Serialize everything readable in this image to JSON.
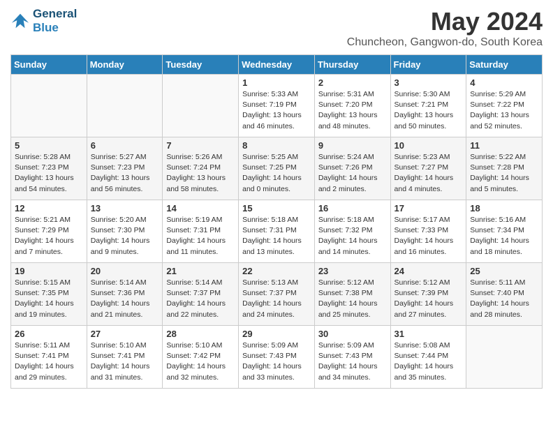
{
  "header": {
    "logo_line1": "General",
    "logo_line2": "Blue",
    "title": "May 2024",
    "subtitle": "Chuncheon, Gangwon-do, South Korea"
  },
  "weekdays": [
    "Sunday",
    "Monday",
    "Tuesday",
    "Wednesday",
    "Thursday",
    "Friday",
    "Saturday"
  ],
  "weeks": [
    [
      {
        "day": "",
        "info": ""
      },
      {
        "day": "",
        "info": ""
      },
      {
        "day": "",
        "info": ""
      },
      {
        "day": "1",
        "info": "Sunrise: 5:33 AM\nSunset: 7:19 PM\nDaylight: 13 hours and 46 minutes."
      },
      {
        "day": "2",
        "info": "Sunrise: 5:31 AM\nSunset: 7:20 PM\nDaylight: 13 hours and 48 minutes."
      },
      {
        "day": "3",
        "info": "Sunrise: 5:30 AM\nSunset: 7:21 PM\nDaylight: 13 hours and 50 minutes."
      },
      {
        "day": "4",
        "info": "Sunrise: 5:29 AM\nSunset: 7:22 PM\nDaylight: 13 hours and 52 minutes."
      }
    ],
    [
      {
        "day": "5",
        "info": "Sunrise: 5:28 AM\nSunset: 7:23 PM\nDaylight: 13 hours and 54 minutes."
      },
      {
        "day": "6",
        "info": "Sunrise: 5:27 AM\nSunset: 7:23 PM\nDaylight: 13 hours and 56 minutes."
      },
      {
        "day": "7",
        "info": "Sunrise: 5:26 AM\nSunset: 7:24 PM\nDaylight: 13 hours and 58 minutes."
      },
      {
        "day": "8",
        "info": "Sunrise: 5:25 AM\nSunset: 7:25 PM\nDaylight: 14 hours and 0 minutes."
      },
      {
        "day": "9",
        "info": "Sunrise: 5:24 AM\nSunset: 7:26 PM\nDaylight: 14 hours and 2 minutes."
      },
      {
        "day": "10",
        "info": "Sunrise: 5:23 AM\nSunset: 7:27 PM\nDaylight: 14 hours and 4 minutes."
      },
      {
        "day": "11",
        "info": "Sunrise: 5:22 AM\nSunset: 7:28 PM\nDaylight: 14 hours and 5 minutes."
      }
    ],
    [
      {
        "day": "12",
        "info": "Sunrise: 5:21 AM\nSunset: 7:29 PM\nDaylight: 14 hours and 7 minutes."
      },
      {
        "day": "13",
        "info": "Sunrise: 5:20 AM\nSunset: 7:30 PM\nDaylight: 14 hours and 9 minutes."
      },
      {
        "day": "14",
        "info": "Sunrise: 5:19 AM\nSunset: 7:31 PM\nDaylight: 14 hours and 11 minutes."
      },
      {
        "day": "15",
        "info": "Sunrise: 5:18 AM\nSunset: 7:31 PM\nDaylight: 14 hours and 13 minutes."
      },
      {
        "day": "16",
        "info": "Sunrise: 5:18 AM\nSunset: 7:32 PM\nDaylight: 14 hours and 14 minutes."
      },
      {
        "day": "17",
        "info": "Sunrise: 5:17 AM\nSunset: 7:33 PM\nDaylight: 14 hours and 16 minutes."
      },
      {
        "day": "18",
        "info": "Sunrise: 5:16 AM\nSunset: 7:34 PM\nDaylight: 14 hours and 18 minutes."
      }
    ],
    [
      {
        "day": "19",
        "info": "Sunrise: 5:15 AM\nSunset: 7:35 PM\nDaylight: 14 hours and 19 minutes."
      },
      {
        "day": "20",
        "info": "Sunrise: 5:14 AM\nSunset: 7:36 PM\nDaylight: 14 hours and 21 minutes."
      },
      {
        "day": "21",
        "info": "Sunrise: 5:14 AM\nSunset: 7:37 PM\nDaylight: 14 hours and 22 minutes."
      },
      {
        "day": "22",
        "info": "Sunrise: 5:13 AM\nSunset: 7:37 PM\nDaylight: 14 hours and 24 minutes."
      },
      {
        "day": "23",
        "info": "Sunrise: 5:12 AM\nSunset: 7:38 PM\nDaylight: 14 hours and 25 minutes."
      },
      {
        "day": "24",
        "info": "Sunrise: 5:12 AM\nSunset: 7:39 PM\nDaylight: 14 hours and 27 minutes."
      },
      {
        "day": "25",
        "info": "Sunrise: 5:11 AM\nSunset: 7:40 PM\nDaylight: 14 hours and 28 minutes."
      }
    ],
    [
      {
        "day": "26",
        "info": "Sunrise: 5:11 AM\nSunset: 7:41 PM\nDaylight: 14 hours and 29 minutes."
      },
      {
        "day": "27",
        "info": "Sunrise: 5:10 AM\nSunset: 7:41 PM\nDaylight: 14 hours and 31 minutes."
      },
      {
        "day": "28",
        "info": "Sunrise: 5:10 AM\nSunset: 7:42 PM\nDaylight: 14 hours and 32 minutes."
      },
      {
        "day": "29",
        "info": "Sunrise: 5:09 AM\nSunset: 7:43 PM\nDaylight: 14 hours and 33 minutes."
      },
      {
        "day": "30",
        "info": "Sunrise: 5:09 AM\nSunset: 7:43 PM\nDaylight: 14 hours and 34 minutes."
      },
      {
        "day": "31",
        "info": "Sunrise: 5:08 AM\nSunset: 7:44 PM\nDaylight: 14 hours and 35 minutes."
      },
      {
        "day": "",
        "info": ""
      }
    ]
  ]
}
